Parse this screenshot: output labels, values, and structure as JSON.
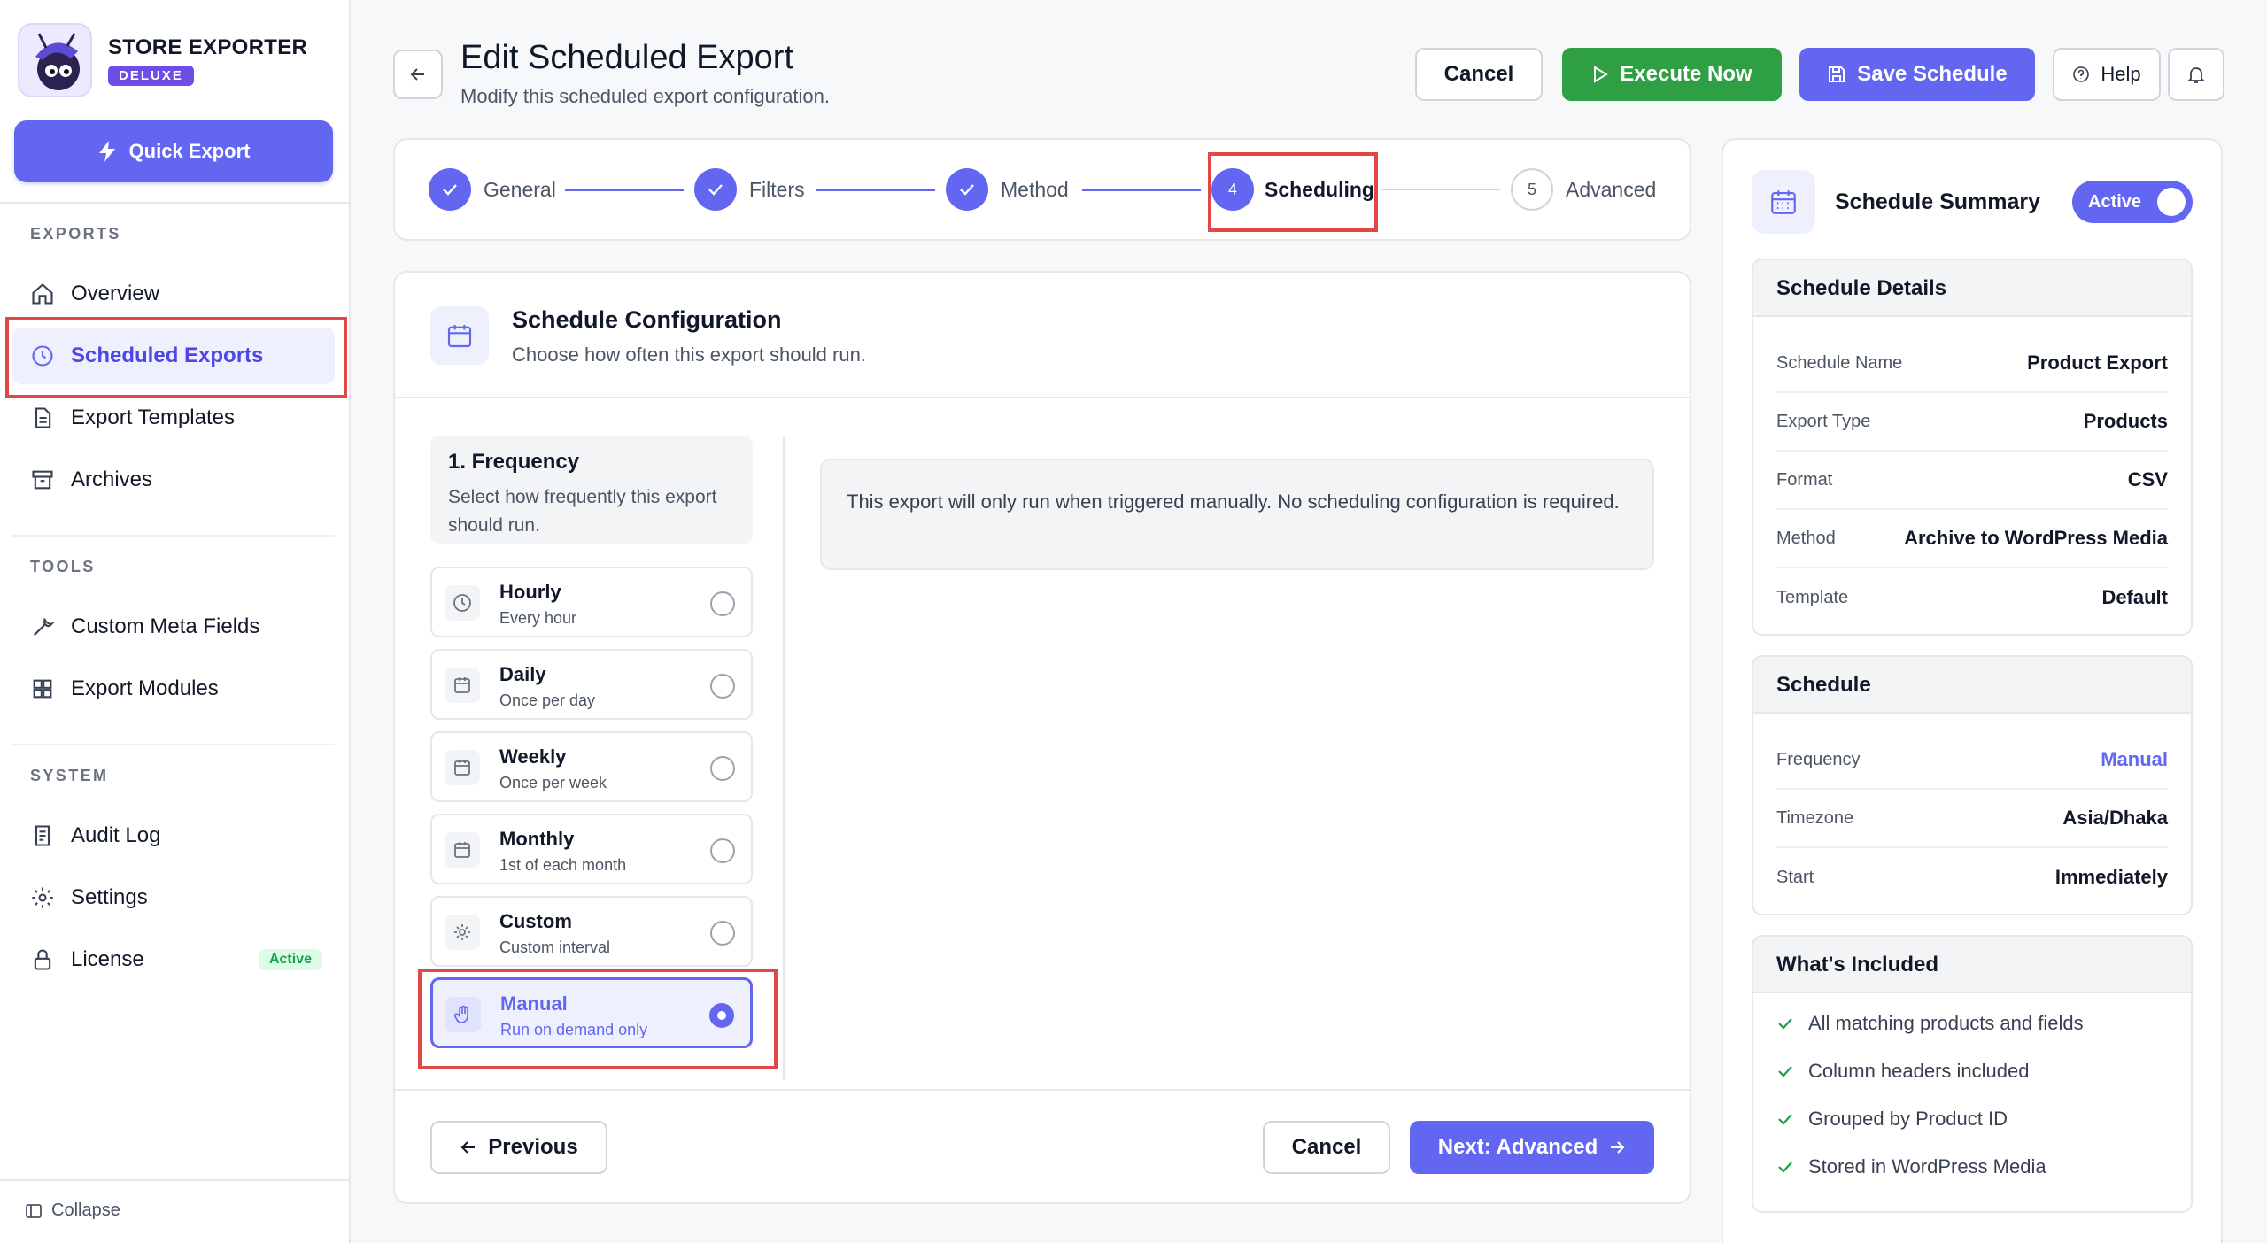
{
  "brand": {
    "name": "STORE EXPORTER",
    "badge": "DELUXE"
  },
  "sidebar": {
    "quick_export": "Quick Export",
    "sections": {
      "exports": "EXPORTS",
      "tools": "TOOLS",
      "system": "SYSTEM"
    },
    "items": [
      {
        "label": "Overview",
        "icon": "home-icon"
      },
      {
        "label": "Scheduled Exports",
        "icon": "clock-icon",
        "active": true
      },
      {
        "label": "Export Templates",
        "icon": "document-icon"
      },
      {
        "label": "Archives",
        "icon": "archive-icon"
      },
      {
        "label": "Custom Meta Fields",
        "icon": "wrench-icon"
      },
      {
        "label": "Export Modules",
        "icon": "grid-icon"
      },
      {
        "label": "Audit Log",
        "icon": "log-icon"
      },
      {
        "label": "Settings",
        "icon": "gear-icon"
      },
      {
        "label": "License",
        "icon": "lock-icon",
        "badge": "Active"
      }
    ],
    "collapse": "Collapse"
  },
  "header": {
    "title": "Edit Scheduled Export",
    "subtitle": "Modify this scheduled export configuration.",
    "cancel": "Cancel",
    "execute": "Execute Now",
    "save": "Save Schedule",
    "help": "Help"
  },
  "stepper": {
    "steps": [
      {
        "label": "General",
        "state": "done"
      },
      {
        "label": "Filters",
        "state": "done"
      },
      {
        "label": "Method",
        "state": "done"
      },
      {
        "label": "Scheduling",
        "number": "4",
        "state": "current"
      },
      {
        "label": "Advanced",
        "number": "5",
        "state": "todo"
      }
    ]
  },
  "config": {
    "title": "Schedule Configuration",
    "subtitle": "Choose how often this export should run.",
    "frequency_title": "1. Frequency",
    "frequency_desc": "Select how frequently this export should run.",
    "options": [
      {
        "label": "Hourly",
        "sub": "Every hour",
        "icon": "clock-icon"
      },
      {
        "label": "Daily",
        "sub": "Once per day",
        "icon": "calendar-icon"
      },
      {
        "label": "Weekly",
        "sub": "Once per week",
        "icon": "calendar-icon"
      },
      {
        "label": "Monthly",
        "sub": "1st of each month",
        "icon": "calendar-icon"
      },
      {
        "label": "Custom",
        "sub": "Custom interval",
        "icon": "gear-icon"
      },
      {
        "label": "Manual",
        "sub": "Run on demand only",
        "icon": "hand-icon",
        "selected": true
      }
    ],
    "info": "This export will only run when triggered manually. No scheduling configuration is required."
  },
  "footer": {
    "previous": "Previous",
    "cancel": "Cancel",
    "next": "Next: Advanced"
  },
  "summary": {
    "title": "Schedule Summary",
    "toggle": "Active",
    "details_title": "Schedule Details",
    "details": [
      {
        "k": "Schedule Name",
        "v": "Product Export"
      },
      {
        "k": "Export Type",
        "v": "Products"
      },
      {
        "k": "Format",
        "v": "CSV"
      },
      {
        "k": "Method",
        "v": "Archive to WordPress Media"
      },
      {
        "k": "Template",
        "v": "Default"
      }
    ],
    "schedule_title": "Schedule",
    "schedule": [
      {
        "k": "Frequency",
        "v": "Manual"
      },
      {
        "k": "Timezone",
        "v": "Asia/Dhaka"
      },
      {
        "k": "Start",
        "v": "Immediately"
      }
    ],
    "included_title": "What's Included",
    "included": [
      "All matching products and fields",
      "Column headers included",
      "Grouped by Product ID",
      "Stored in WordPress Media"
    ]
  },
  "colors": {
    "accent": "#6366f1",
    "success": "#2ea043",
    "highlight": "#e04848"
  }
}
